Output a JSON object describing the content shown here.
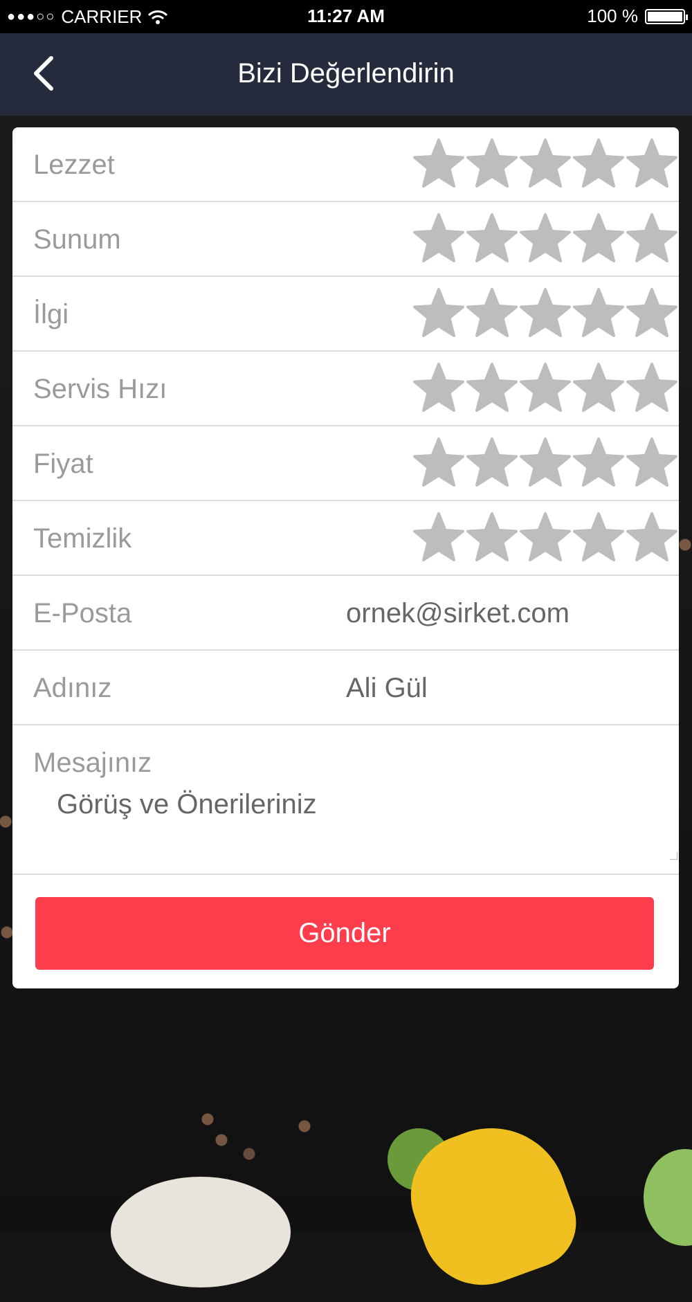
{
  "status_bar": {
    "carrier": "CARRIER",
    "time": "11:27 AM",
    "battery": "100 %"
  },
  "nav": {
    "title": "Bizi Değerlendirin",
    "back_icon": "chevron-left-icon"
  },
  "ratings": [
    {
      "label": "Lezzet",
      "stars": 5,
      "filled": 0
    },
    {
      "label": "Sunum",
      "stars": 5,
      "filled": 0
    },
    {
      "label": "İlgi",
      "stars": 5,
      "filled": 0
    },
    {
      "label": "Servis Hızı",
      "stars": 5,
      "filled": 0
    },
    {
      "label": "Fiyat",
      "stars": 5,
      "filled": 0
    },
    {
      "label": "Temizlik",
      "stars": 5,
      "filled": 0
    }
  ],
  "form": {
    "email_label": "E-Posta",
    "email_placeholder": "ornek@sirket.com",
    "name_label": "Adınız",
    "name_placeholder": "Ali Gül",
    "message_label": "Mesajınız",
    "message_placeholder": "Görüş ve Önerileriniz"
  },
  "submit_label": "Gönder",
  "colors": {
    "navbar": "#252b3c",
    "accent": "#fd3c4c",
    "star_empty": "#bdbdbd",
    "label": "#9a9a9a"
  }
}
